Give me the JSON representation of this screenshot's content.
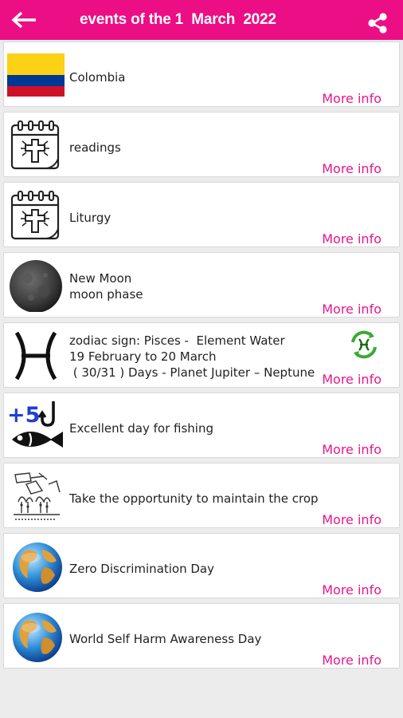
{
  "header": {
    "title": "events of the 1  March  2022"
  },
  "events": [
    {
      "lines": [
        "Colombia"
      ],
      "more": "More info",
      "icon": "colombia-flag-icon"
    },
    {
      "lines": [
        "readings"
      ],
      "more": "More info",
      "icon": "calendar-cross-icon"
    },
    {
      "lines": [
        "Liturgy"
      ],
      "more": "More info",
      "icon": "calendar-cross-icon"
    },
    {
      "lines": [
        "New Moon",
        "moon phase"
      ],
      "more": "More info",
      "icon": "moon-icon"
    },
    {
      "lines": [
        "zodiac sign: Pisces -  Element Water",
        "19 February to 20 March",
        " ( 30/31 ) Days - Planet Jupiter – Neptune"
      ],
      "more": "More info",
      "icon": "pisces-icon",
      "badge": "recycle-pisces-icon"
    },
    {
      "lines": [
        "Excellent day for fishing"
      ],
      "more": "More info",
      "icon": "fishing-icon",
      "icon_text": "+5"
    },
    {
      "lines": [
        "Take the opportunity to maintain the crop"
      ],
      "more": "More info",
      "icon": "crop-sketch-icon"
    },
    {
      "lines": [
        "Zero Discrimination Day"
      ],
      "more": "More info",
      "icon": "globe-icon"
    },
    {
      "lines": [
        "World Self Harm Awareness Day"
      ],
      "more": "More info",
      "icon": "globe-icon"
    }
  ],
  "colors": {
    "accent": "#ec0e84",
    "link": "#e8168a",
    "background": "#ececec",
    "card": "#ffffff"
  }
}
